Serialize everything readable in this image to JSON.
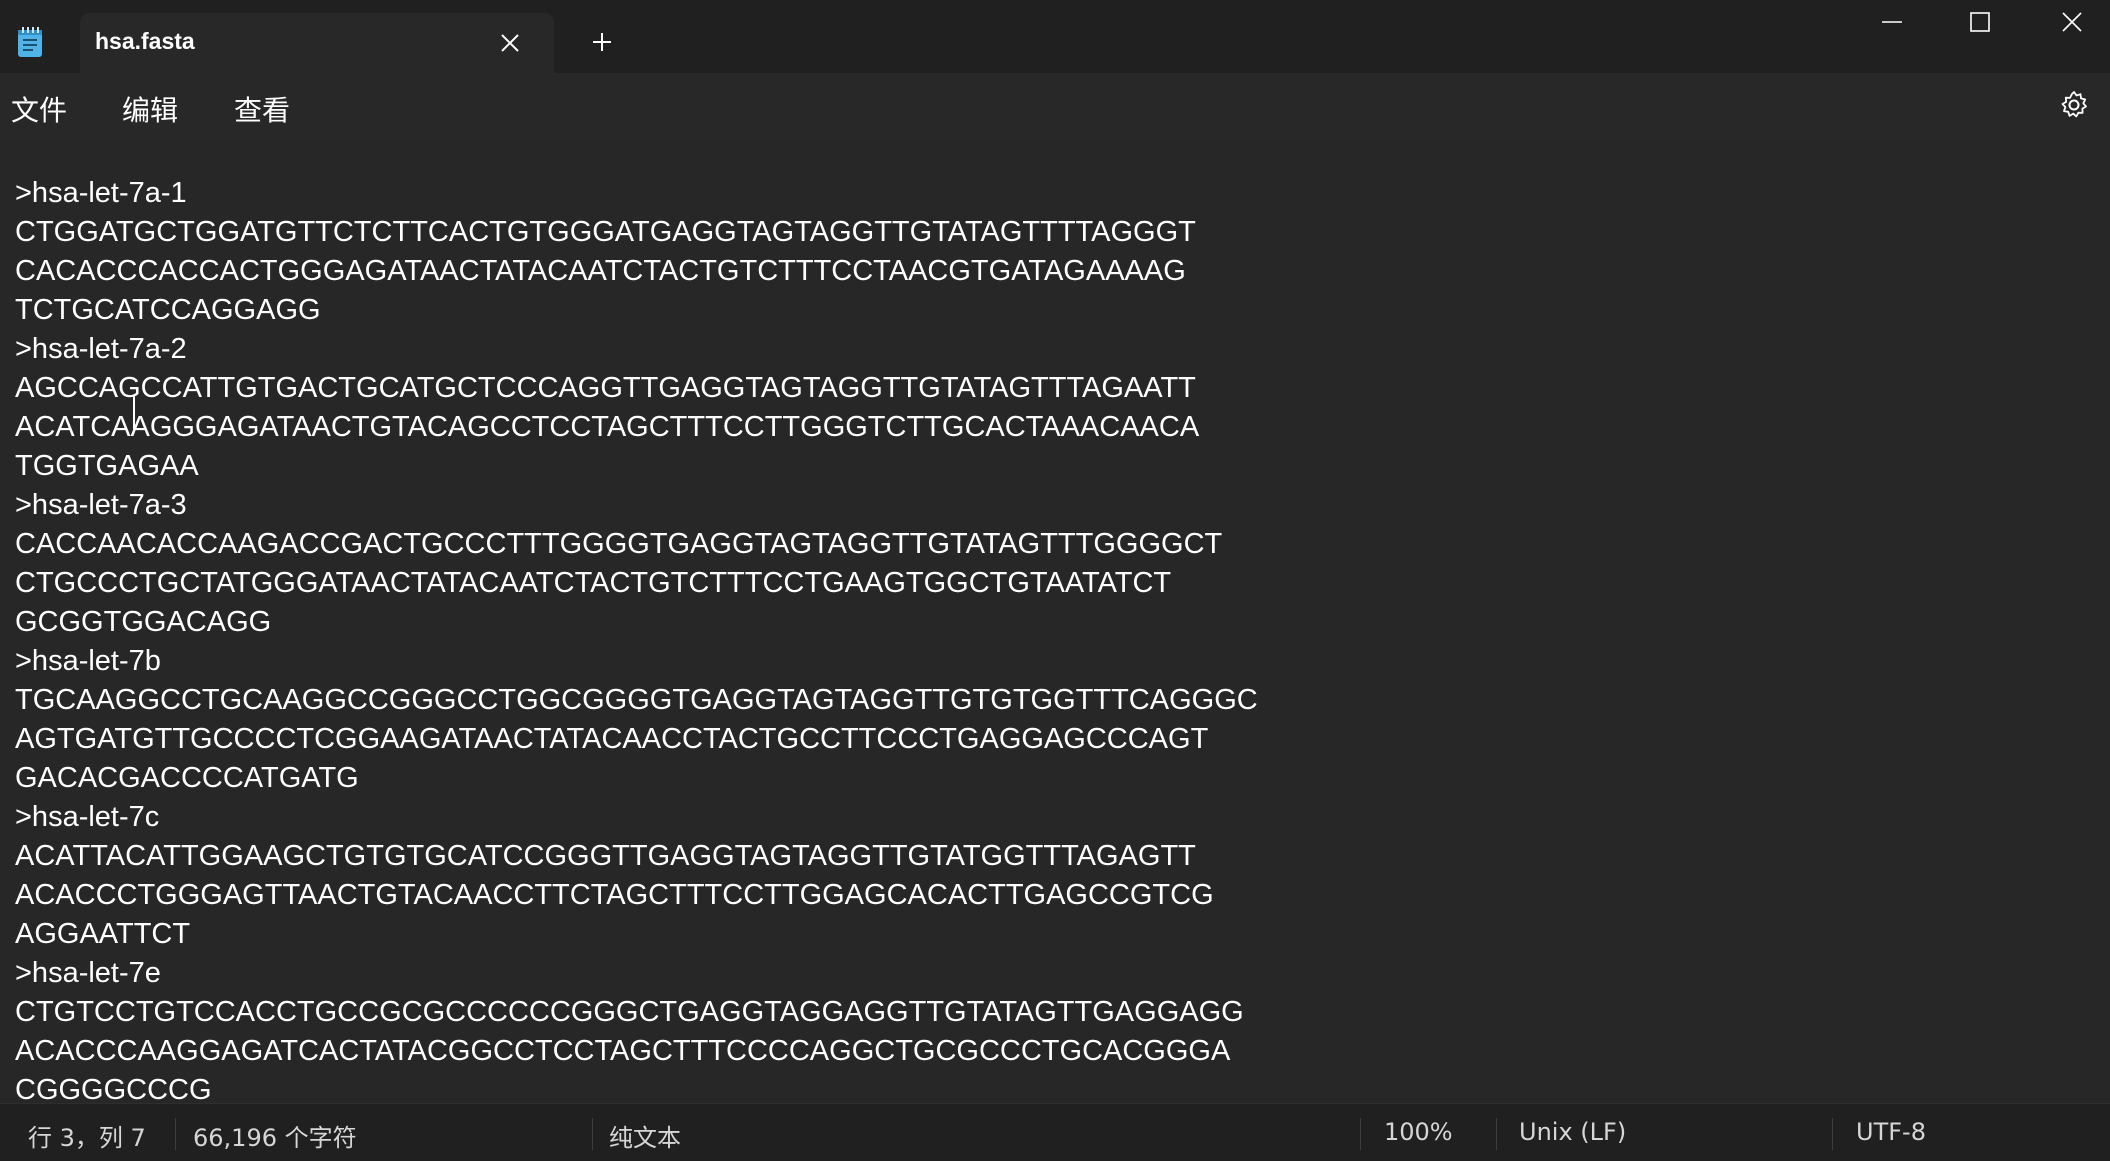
{
  "window": {
    "tab_title": "hsa.fasta"
  },
  "menu": {
    "file": "文件",
    "edit": "编辑",
    "view": "查看"
  },
  "editor": {
    "lines": [
      ">hsa-let-7a-1",
      "CTGGATGCTGGATGTTCTCTTCACTGTGGGATGAGGTAGTAGGTTGTATAGTTTTAGGGT",
      "CACACCCACCACTGGGAGATAACTATACAATCTACTGTCTTTCCTAACGTGATAGAAAAG",
      "TCTGCATCCAGGAGG",
      ">hsa-let-7a-2",
      "AGCCAGCCATTGTGACTGCATGCTCCCAGGTTGAGGTAGTAGGTTGTATAGTTTAGAATT",
      "ACATCAAGGGAGATAACTGTACAGCCTCCTAGCTTTCCTTGGGTCTTGCACTAAACAACA",
      "TGGTGAGAA",
      ">hsa-let-7a-3",
      "CACCAACACCAAGACCGACTGCCCTTTGGGGTGAGGTAGTAGGTTGTATAGTTTGGGGCT",
      "CTGCCCTGCTATGGGATAACTATACAATCTACTGTCTTTCCTGAAGTGGCTGTAATATCT",
      "GCGGTGGACAGG",
      ">hsa-let-7b",
      "TGCAAGGCCTGCAAGGCCGGGCCTGGCGGGGTGAGGTAGTAGGTTGTGTGGTTTCAGGGC",
      "AGTGATGTTGCCCCTCGGAAGATAACTATACAACCTACTGCCTTCCCTGAGGAGCCCAGT",
      "GACACGACCCCATGATG",
      ">hsa-let-7c",
      "ACATTACATTGGAAGCTGTGTGCATCCGGGTTGAGGTAGTAGGTTGTATGGTTTAGAGTT",
      "ACACCCTGGGAGTTAACTGTACAACCTTCTAGCTTTCCTTGGAGCACACTTGAGCCGTCG",
      "AGGAATTCT",
      ">hsa-let-7e",
      "CTGTCCTGTCCACCTGCCGCGCCCCCCGGGCTGAGGTAGGAGGTTGTATAGTTGAGGAGG",
      "ACACCCAAGGAGATCACTATACGGCCTCCTAGCTTTCCCCAGGCTGCGCCCTGCACGGGA",
      "CGGGGCCCG"
    ]
  },
  "status": {
    "position": "行 3，列 7",
    "char_count": "66,196 个字符",
    "format": "纯文本",
    "zoom": "100%",
    "line_ending": "Unix (LF)",
    "encoding": "UTF-8"
  },
  "icons": {
    "app": "notepad-icon",
    "tab_close": "close-icon",
    "new_tab": "plus-icon",
    "minimize": "minimize-icon",
    "maximize": "maximize-icon",
    "close": "close-icon",
    "settings": "gear-icon"
  },
  "colors": {
    "background": "#272727",
    "titlebar": "#202020",
    "text": "#ffffff",
    "app_icon": "#4fb3e8"
  }
}
